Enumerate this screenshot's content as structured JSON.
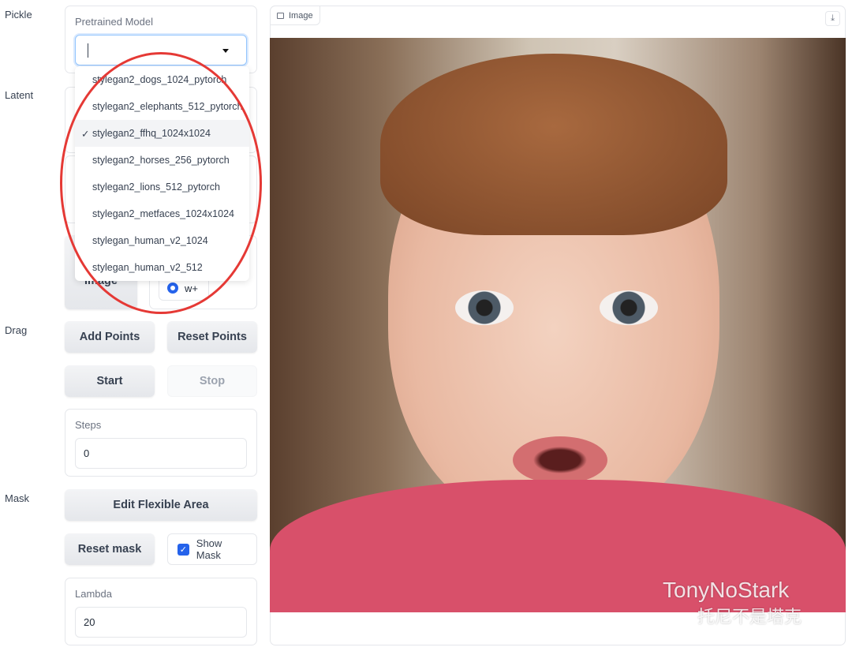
{
  "sections": {
    "pickle": "Pickle",
    "latent": "Latent",
    "drag": "Drag",
    "mask": "Mask"
  },
  "pickle": {
    "label": "Pretrained Model",
    "value": "",
    "options": [
      "stylegan2_dogs_1024_pytorch",
      "stylegan2_elephants_512_pytorch",
      "stylegan2_ffhq_1024x1024",
      "stylegan2_horses_256_pytorch",
      "stylegan2_lions_512_pytorch",
      "stylegan2_metfaces_1024x1024",
      "stylegan_human_v2_1024",
      "stylegan_human_v2_512"
    ],
    "selected_index": 2,
    "check": "✓"
  },
  "latent": {
    "image_button": "Image",
    "radio_label": "w+"
  },
  "drag": {
    "add_points": "Add Points",
    "reset_points": "Reset Points",
    "start": "Start",
    "stop": "Stop",
    "steps_label": "Steps",
    "steps_value": "0"
  },
  "mask": {
    "edit_area": "Edit Flexible Area",
    "reset_mask": "Reset mask",
    "show_mask": "Show Mask",
    "show_mask_checked": true,
    "lambda_label": "Lambda",
    "lambda_value": "20"
  },
  "image": {
    "tab_label": "Image"
  },
  "watermark": {
    "line1": "TonyNoStark",
    "line2": "托尼不是塔克"
  },
  "colors": {
    "accent": "#2563eb",
    "annotation": "#e53935"
  }
}
